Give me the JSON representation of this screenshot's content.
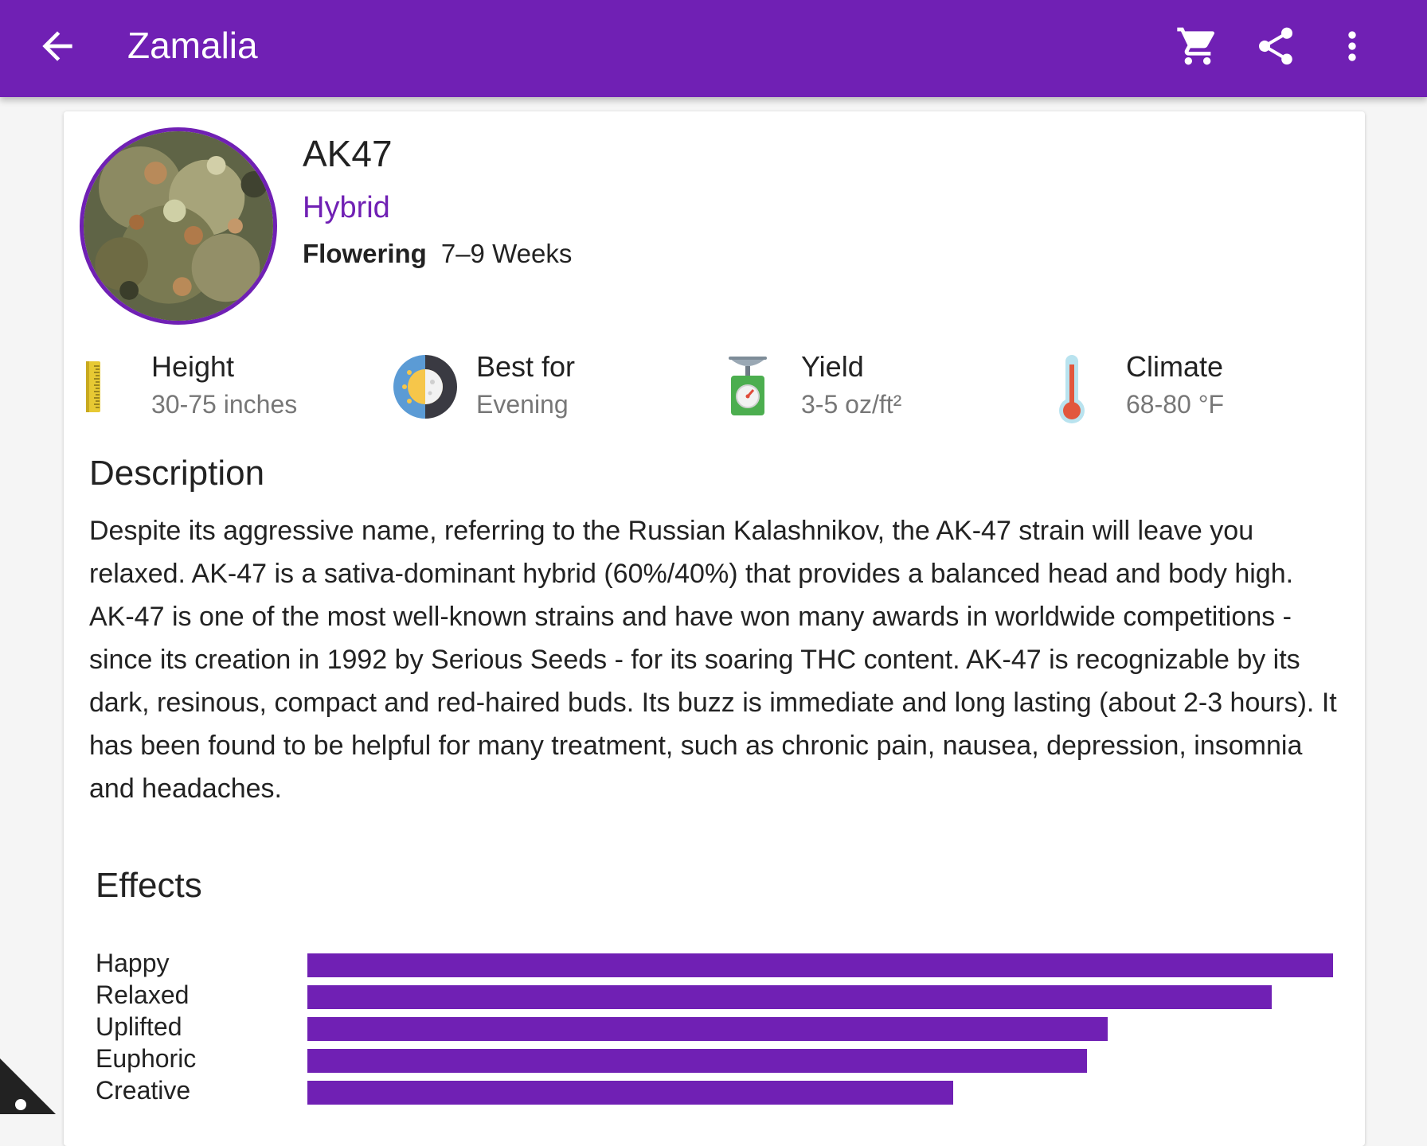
{
  "app": {
    "title": "Zamalia",
    "accent": "#7020b4",
    "icons": [
      "arrow-back-icon",
      "cart-icon",
      "share-icon",
      "more-vert-icon"
    ]
  },
  "strain": {
    "name": "AK47",
    "type": "Hybrid",
    "flowering_label": "Flowering",
    "flowering_value": "7–9 Weeks"
  },
  "stats": [
    {
      "label": "Height",
      "value": "30-75 inches",
      "icon": "ruler-icon"
    },
    {
      "label": "Best for",
      "value": "Evening",
      "icon": "day-night-icon"
    },
    {
      "label": "Yield",
      "value": "3-5 oz/ft²",
      "icon": "scale-icon"
    },
    {
      "label": "Climate",
      "value": "68-80 °F",
      "icon": "thermometer-icon"
    }
  ],
  "description": {
    "heading": "Description",
    "text": "Despite its aggressive name, referring to the Russian Kalashnikov, the AK-47 strain will leave you relaxed. AK-47 is a sativa-dominant hybrid (60%/40%) that provides a balanced head and body high. AK-47 is one of the most well-known strains and have won many awards in worldwide competitions - since its creation in 1992 by Serious Seeds - for its soaring THC content. AK-47 is recognizable by its dark, resinous, compact and red-haired buds. Its buzz is immediate and long lasting (about 2-3 hours). It has been found to be helpful for many treatment, such as chronic pain, nausea, depression, insomnia and headaches."
  },
  "effects": {
    "heading": "Effects",
    "items": [
      {
        "label": "Happy",
        "level": 1.0
      },
      {
        "label": "Relaxed",
        "level": 0.94
      },
      {
        "label": "Uplifted",
        "level": 0.78
      },
      {
        "label": "Euphoric",
        "level": 0.76
      },
      {
        "label": "Creative",
        "level": 0.63
      }
    ]
  }
}
